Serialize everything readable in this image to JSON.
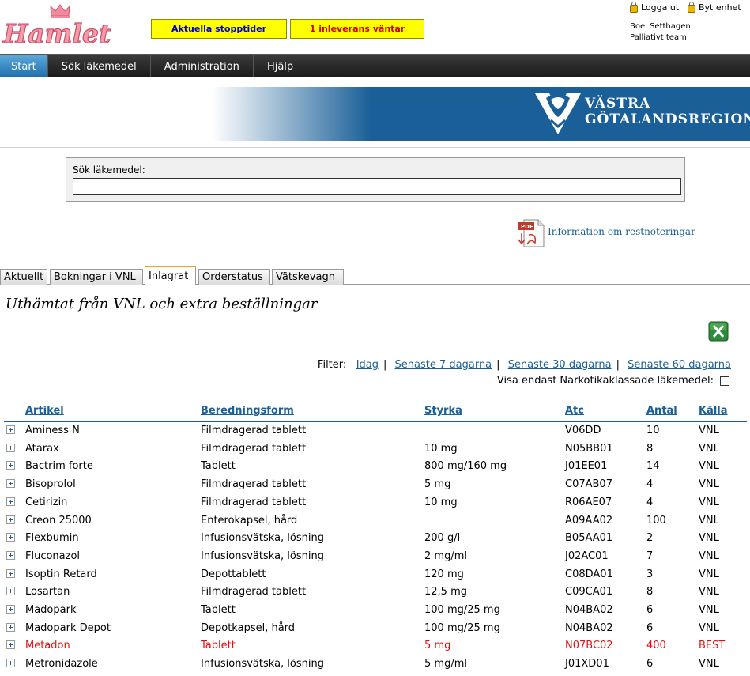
{
  "header": {
    "logo_text": "Hamlet",
    "btn_stopptider": "Aktuella stopptider",
    "btn_inleverans": "1 inleverans väntar",
    "logout": "Logga ut",
    "switch_unit": "Byt enhet",
    "user_name": "Boel Setthagen",
    "user_team": "Palliativt team"
  },
  "nav": {
    "items": [
      {
        "label": "Start",
        "active": true
      },
      {
        "label": "Sök läkemedel"
      },
      {
        "label": "Administration"
      },
      {
        "label": "Hjälp"
      }
    ]
  },
  "banner": {
    "line1": "VÄSTRA",
    "line2": "GÖTALANDSREGIONEN"
  },
  "search": {
    "label": "Sök läkemedel:",
    "value": "",
    "placeholder": ""
  },
  "pdf_link": "Information om restnoteringar",
  "tabs": [
    {
      "label": "Aktuellt"
    },
    {
      "label": "Bokningar i VNL"
    },
    {
      "label": "Inlagrat",
      "active": true
    },
    {
      "label": "Orderstatus"
    },
    {
      "label": "Vätskevagn"
    }
  ],
  "page_heading": "Uthämtat från VNL och extra beställningar",
  "filter": {
    "label": "Filter:",
    "options": [
      "Idag",
      "Senaste 7 dagarna",
      "Senaste 30 dagarna",
      "Senaste 60 dagarna"
    ],
    "narko_label": "Visa endast Narkotikaklassade läkemedel:",
    "narko_checked": false
  },
  "table": {
    "columns": [
      "Artikel",
      "Beredningsform",
      "Styrka",
      "Atc",
      "Antal",
      "Källa"
    ],
    "rows": [
      {
        "artikel": "Aminess N",
        "beredningsform": "Filmdragerad tablett",
        "styrka": "",
        "atc": "V06DD",
        "antal": "10",
        "kalla": "VNL"
      },
      {
        "artikel": "Atarax",
        "beredningsform": "Filmdragerad tablett",
        "styrka": "10 mg",
        "atc": "N05BB01",
        "antal": "8",
        "kalla": "VNL"
      },
      {
        "artikel": "Bactrim forte",
        "beredningsform": "Tablett",
        "styrka": "800 mg/160 mg",
        "atc": "J01EE01",
        "antal": "14",
        "kalla": "VNL"
      },
      {
        "artikel": "Bisoprolol",
        "beredningsform": "Filmdragerad tablett",
        "styrka": "5 mg",
        "atc": "C07AB07",
        "antal": "4",
        "kalla": "VNL"
      },
      {
        "artikel": "Cetirizin",
        "beredningsform": "Filmdragerad tablett",
        "styrka": "10 mg",
        "atc": "R06AE07",
        "antal": "4",
        "kalla": "VNL"
      },
      {
        "artikel": "Creon 25000",
        "beredningsform": "Enterokapsel, hård",
        "styrka": "",
        "atc": "A09AA02",
        "antal": "100",
        "kalla": "VNL"
      },
      {
        "artikel": "Flexbumin",
        "beredningsform": "Infusionsvätska, lösning",
        "styrka": "200 g/l",
        "atc": "B05AA01",
        "antal": "2",
        "kalla": "VNL"
      },
      {
        "artikel": "Fluconazol",
        "beredningsform": "Infusionsvätska, lösning",
        "styrka": "2 mg/ml",
        "atc": "J02AC01",
        "antal": "7",
        "kalla": "VNL"
      },
      {
        "artikel": "Isoptin Retard",
        "beredningsform": "Depottablett",
        "styrka": "120 mg",
        "atc": "C08DA01",
        "antal": "3",
        "kalla": "VNL"
      },
      {
        "artikel": "Losartan",
        "beredningsform": "Filmdragerad tablett",
        "styrka": "12,5 mg",
        "atc": "C09CA01",
        "antal": "8",
        "kalla": "VNL"
      },
      {
        "artikel": "Madopark",
        "beredningsform": "Tablett",
        "styrka": "100 mg/25 mg",
        "atc": "N04BA02",
        "antal": "6",
        "kalla": "VNL"
      },
      {
        "artikel": "Madopark Depot",
        "beredningsform": "Depotkapsel, hård",
        "styrka": "100 mg/25 mg",
        "atc": "N04BA02",
        "antal": "6",
        "kalla": "VNL"
      },
      {
        "artikel": "Metadon",
        "beredningsform": "Tablett",
        "styrka": "5 mg",
        "atc": "N07BC02",
        "antal": "400",
        "kalla": "BEST",
        "highlight": true
      },
      {
        "artikel": "Metronidazole",
        "beredningsform": "Infusionsvätska, lösning",
        "styrka": "5 mg/ml",
        "atc": "J01XD01",
        "antal": "6",
        "kalla": "VNL"
      }
    ]
  },
  "colors": {
    "accent": "#1a5f98",
    "highlight": "#e01010",
    "yellow": "#ffff00",
    "tab_active": "#f3a21a"
  }
}
